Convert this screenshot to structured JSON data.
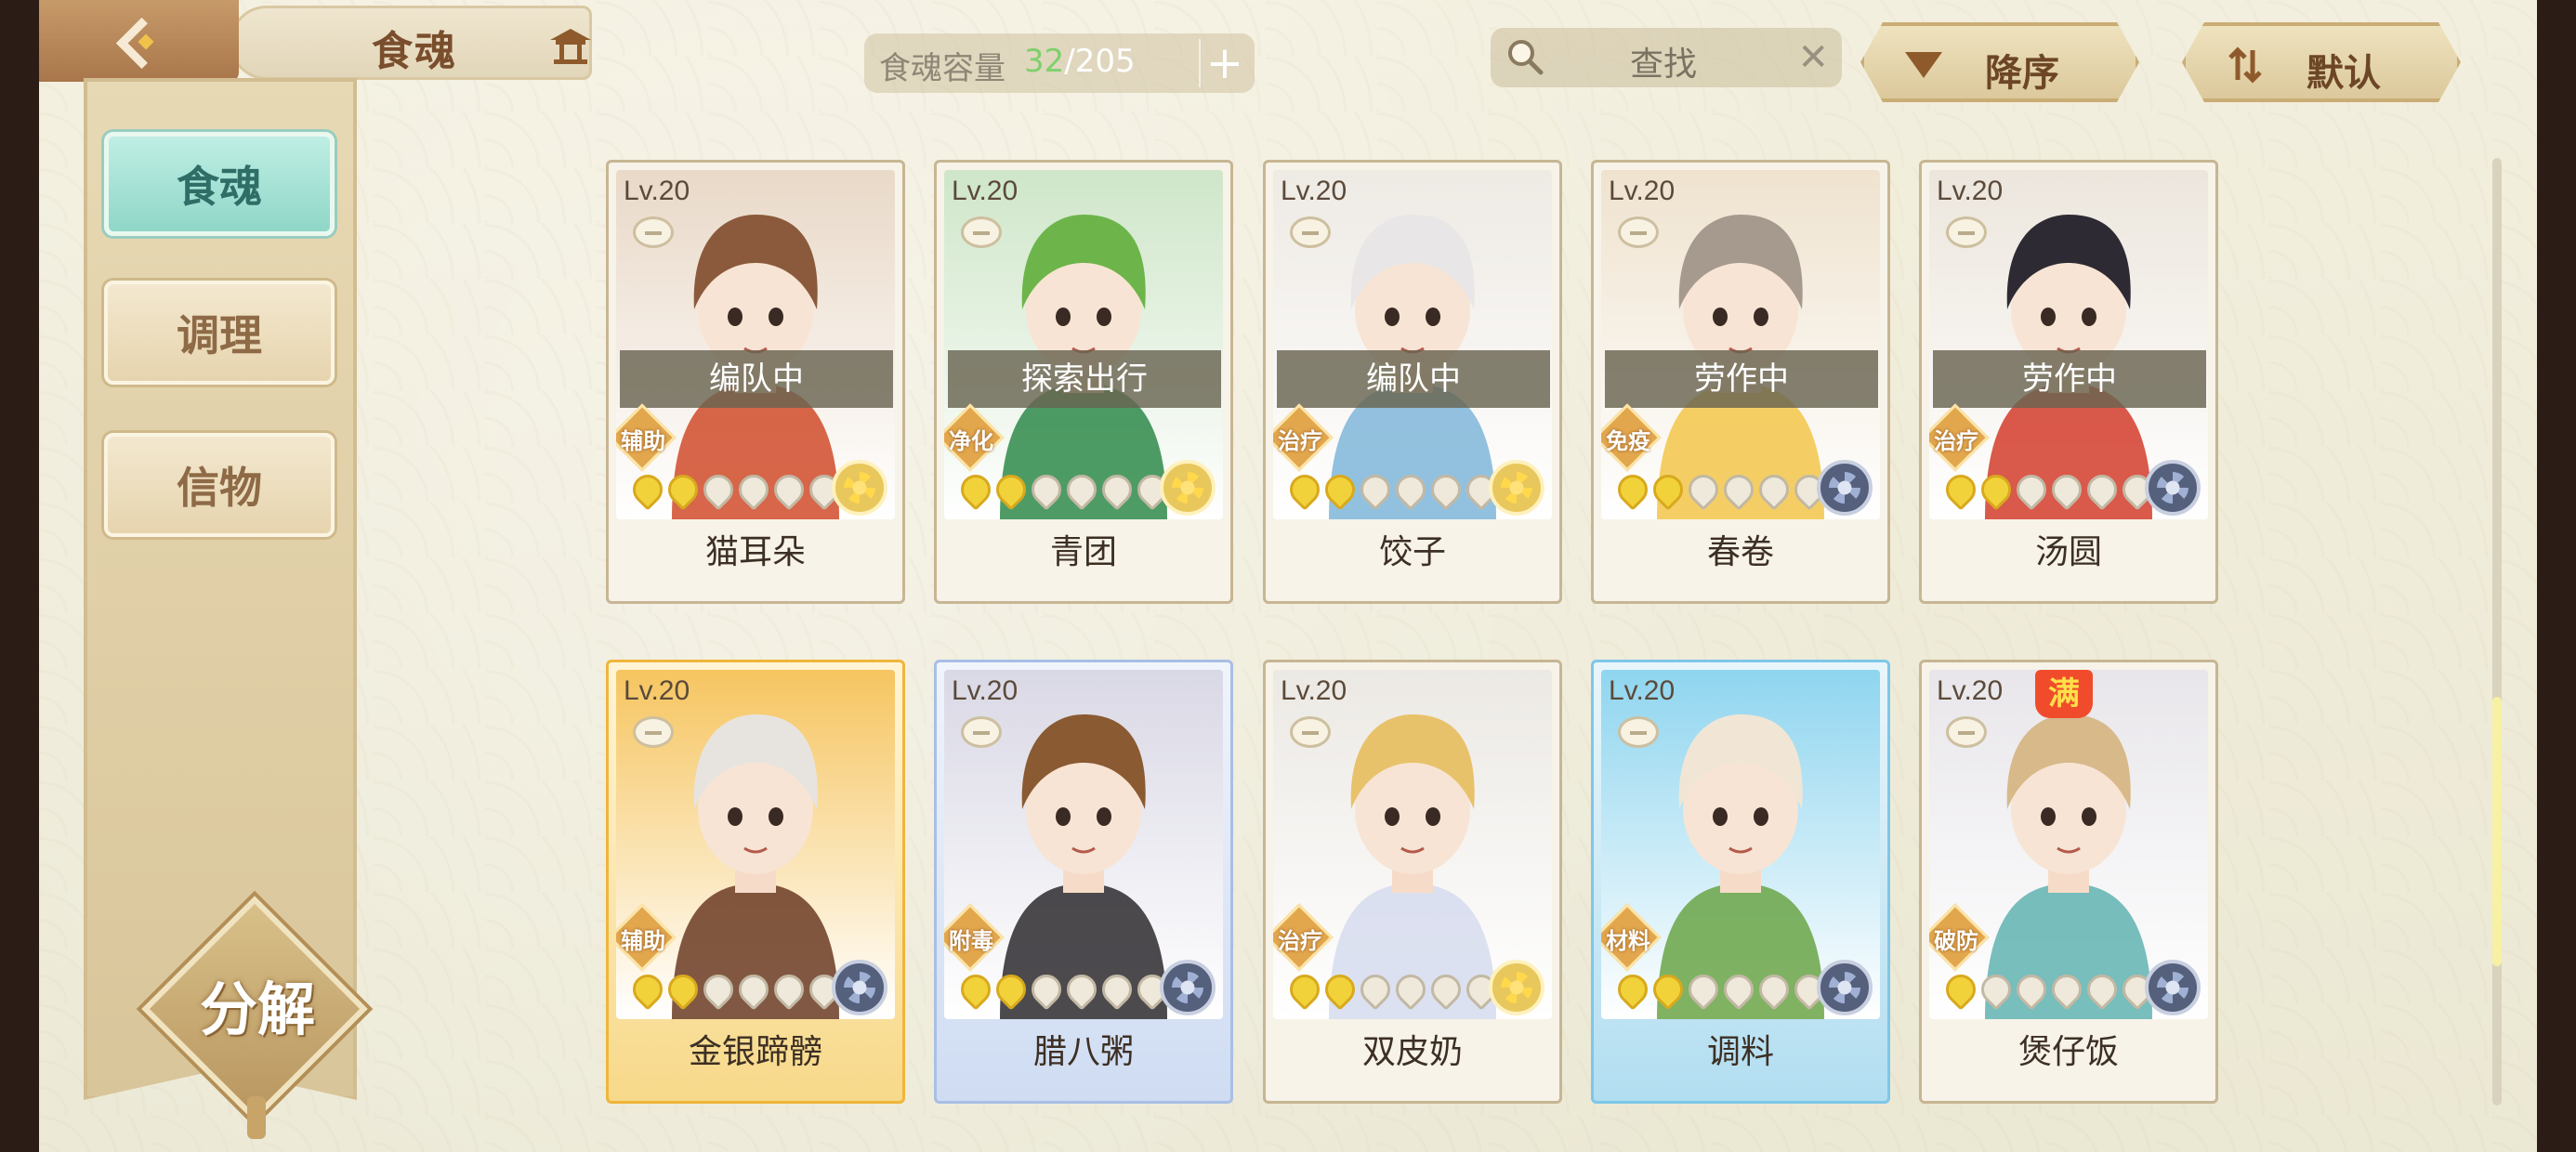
{
  "header": {
    "title": "食魂"
  },
  "capacity": {
    "label": "食魂容量",
    "current": "32",
    "max_text": "/205",
    "add_label": "+"
  },
  "search": {
    "placeholder": "查找",
    "clear_label": "✕"
  },
  "sort": {
    "order_label": "降序",
    "default_label": "默认"
  },
  "sidebar": {
    "tabs": [
      {
        "label": "食魂",
        "active": true
      },
      {
        "label": "调理",
        "active": false
      },
      {
        "label": "信物",
        "active": false
      }
    ],
    "decompose_label": "分解"
  },
  "cards": [
    {
      "level": "Lv.20",
      "status": "编队中",
      "role": "辅助",
      "stars": 2,
      "name": "猫耳朵",
      "element": "gold",
      "frame": "normal",
      "palette": [
        "#e9d9c8",
        "#8b5a3c",
        "#d04b2a"
      ]
    },
    {
      "level": "Lv.20",
      "status": "探索出行",
      "role": "净化",
      "stars": 2,
      "name": "青团",
      "element": "gold",
      "frame": "normal",
      "palette": [
        "#cfe6c9",
        "#6db54b",
        "#2f8a4a"
      ]
    },
    {
      "level": "Lv.20",
      "status": "编队中",
      "role": "治疗",
      "stars": 2,
      "name": "饺子",
      "element": "gold",
      "frame": "normal",
      "palette": [
        "#eeeae4",
        "#e8e6e6",
        "#7fb6d9"
      ]
    },
    {
      "level": "Lv.20",
      "status": "劳作中",
      "role": "免疫",
      "stars": 2,
      "name": "春卷",
      "element": "dark",
      "frame": "normal",
      "palette": [
        "#efe3cf",
        "#a59a8d",
        "#f2c64a"
      ]
    },
    {
      "level": "Lv.20",
      "status": "劳作中",
      "role": "治疗",
      "stars": 2,
      "name": "汤圆",
      "element": "dark",
      "frame": "normal",
      "palette": [
        "#ece6dd",
        "#2e2a33",
        "#d23c2b"
      ]
    },
    {
      "level": "Lv.20",
      "status": "",
      "role": "辅助",
      "stars": 2,
      "name": "金银蹄髈",
      "element": "dark",
      "frame": "gold",
      "palette": [
        "#f6c560",
        "#e7e4df",
        "#6b3b23"
      ]
    },
    {
      "level": "Lv.20",
      "status": "",
      "role": "附毒",
      "stars": 2,
      "name": "腊八粥",
      "element": "dark",
      "frame": "blue",
      "palette": [
        "#d9d8e5",
        "#8a5a32",
        "#2d2a2e"
      ]
    },
    {
      "level": "Lv.20",
      "status": "",
      "role": "治疗",
      "stars": 2,
      "name": "双皮奶",
      "element": "gold",
      "frame": "normal",
      "palette": [
        "#ece9e4",
        "#e8c26a",
        "#d6dcef"
      ]
    },
    {
      "level": "Lv.20",
      "status": "",
      "role": "材料",
      "stars": 2,
      "name": "调料",
      "element": "dark",
      "frame": "cyan",
      "palette": [
        "#8fd5ef",
        "#f1e6d5",
        "#6aa446"
      ]
    },
    {
      "level": "Lv.20",
      "status": "",
      "role": "破防",
      "stars": 1,
      "name": "煲仔饭",
      "element": "dark",
      "frame": "normal",
      "palette": [
        "#e8e6ea",
        "#d7b98a",
        "#5fb3b0"
      ],
      "badge": "满"
    }
  ]
}
